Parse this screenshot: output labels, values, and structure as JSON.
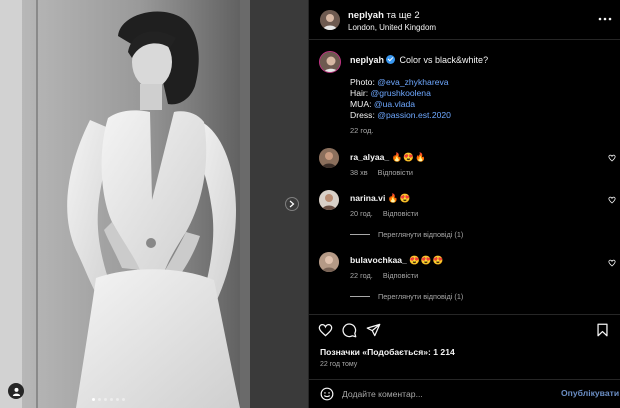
{
  "post": {
    "username": "neplyah",
    "coauthors": "та ще 2",
    "location": "London, United Kingdom",
    "more_icon": "more-horizontal-icon"
  },
  "caption": {
    "username": "neplyah",
    "text": "Color vs black&white?",
    "credits": [
      {
        "role": "Photo:",
        "handle": "@eva_zhykhareva"
      },
      {
        "role": "Hair:",
        "handle": "@grushkoolena"
      },
      {
        "role": "MUA:",
        "handle": "@ua.vlada"
      },
      {
        "role": "Dress:",
        "handle": "@passion.est.2020"
      }
    ],
    "time": "22 год."
  },
  "comments": [
    {
      "username": "ra_alyaa_",
      "text": "🔥😍🔥",
      "time": "38 хв",
      "reply": "Відповісти",
      "view_replies": ""
    },
    {
      "username": "narina.vi",
      "text": "🔥😍",
      "time": "20 год.",
      "reply": "Відповісти",
      "view_replies": "Переглянути відповіді (1)"
    },
    {
      "username": "bulavochkaa_",
      "text": "😍😍😍",
      "time": "22 год.",
      "reply": "Відповісти",
      "view_replies": "Переглянути відповіді (1)"
    }
  ],
  "likes_text": "Позначки «Подобається»: 1 214",
  "post_time": "22 год тому",
  "comment_input": {
    "placeholder": "Додайте коментар...",
    "value": ""
  },
  "post_button": "Опублікувати",
  "carousel": {
    "current_index": 1,
    "total": 6
  },
  "colors": {
    "background": "#000000",
    "text": "#f5f5f5",
    "secondary": "#a8a8a8",
    "link": "#6ea8ff",
    "verified": "#3897f0"
  }
}
